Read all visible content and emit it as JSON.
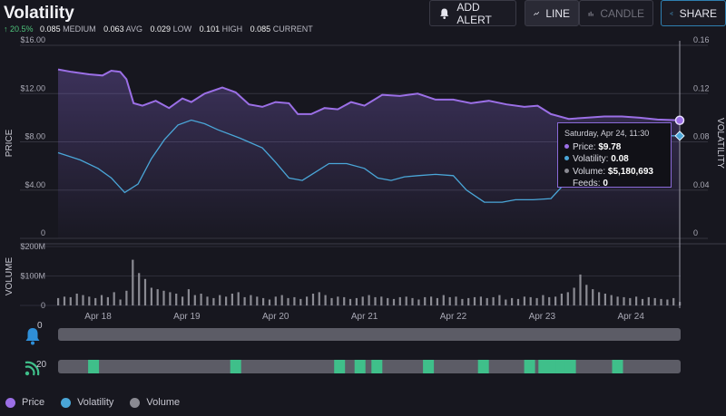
{
  "header": {
    "title": "Volatility",
    "change": "↑ 20.5%",
    "stats": [
      {
        "value": "0.085",
        "label": "MEDIUM"
      },
      {
        "value": "0.063",
        "label": "AVG"
      },
      {
        "value": "0.029",
        "label": "LOW"
      },
      {
        "value": "0.101",
        "label": "HIGH"
      },
      {
        "value": "0.085",
        "label": "CURRENT"
      }
    ]
  },
  "toolbar": {
    "add_alert": "ADD ALERT",
    "line": "LINE",
    "candle": "CANDLE",
    "share": "SHARE"
  },
  "tooltip": {
    "date": "Saturday, Apr 24, 11:30",
    "price_label": "Price:",
    "price": "$9.78",
    "vol_label": "Volatility:",
    "vol": "0.08",
    "volume_label": "Volume:",
    "volume": "$5,180,693",
    "feeds_label": "Feeds:",
    "feeds": "0"
  },
  "lanes": {
    "alerts_count": "0",
    "feeds_count": "20"
  },
  "colors": {
    "price": "#9b6fe6",
    "volatility": "#4aa6d8",
    "volume": "#8a8a92",
    "feed": "#3fbf8a"
  },
  "chart_data": {
    "type": "line",
    "xlabel": "",
    "ylabel": "PRICE",
    "y2label": "VOLATILITY",
    "ylim": [
      0,
      16
    ],
    "y2lim": [
      0,
      0.16
    ],
    "volume_label": "VOLUME",
    "volume_ylim": [
      0,
      200000000
    ],
    "x_ticks": [
      "Apr 18",
      "Apr 19",
      "Apr 20",
      "Apr 21",
      "Apr 22",
      "Apr 23",
      "Apr 24"
    ],
    "y_ticks": [
      "$16.00",
      "$12.00",
      "$8.00",
      "$4.00",
      "0"
    ],
    "y2_ticks": [
      "0.16",
      "0.12",
      "0.08",
      "0.04",
      "0"
    ],
    "volume_ticks": [
      "$200M",
      "$100M",
      "0"
    ],
    "legend": [
      "Price",
      "Volatility",
      "Volume"
    ],
    "x_range": [
      17.55,
      24.55
    ],
    "series": [
      {
        "name": "Price",
        "x": [
          17.55,
          17.7,
          17.9,
          18.05,
          18.15,
          18.25,
          18.32,
          18.4,
          18.5,
          18.65,
          18.8,
          18.95,
          19.05,
          19.2,
          19.4,
          19.55,
          19.7,
          19.85,
          20.0,
          20.15,
          20.25,
          20.4,
          20.55,
          20.7,
          20.85,
          21.0,
          21.2,
          21.4,
          21.6,
          21.8,
          22.0,
          22.2,
          22.4,
          22.6,
          22.8,
          22.95,
          23.1,
          23.3,
          23.5,
          23.7,
          23.9,
          24.1,
          24.3,
          24.55
        ],
        "values": [
          14.0,
          13.8,
          13.6,
          13.5,
          13.9,
          13.8,
          13.2,
          11.2,
          11.0,
          11.4,
          10.8,
          11.6,
          11.3,
          12.0,
          12.5,
          12.1,
          11.1,
          10.9,
          11.3,
          11.2,
          10.3,
          10.3,
          10.8,
          10.7,
          11.3,
          11.0,
          11.9,
          11.8,
          12.0,
          11.5,
          11.5,
          11.2,
          11.4,
          11.1,
          10.9,
          11.0,
          10.3,
          9.9,
          10.0,
          10.1,
          10.1,
          10.0,
          9.85,
          9.78
        ]
      },
      {
        "name": "Volatility",
        "x": [
          17.55,
          17.8,
          18.0,
          18.15,
          18.3,
          18.45,
          18.6,
          18.75,
          18.9,
          19.05,
          19.2,
          19.35,
          19.6,
          19.85,
          20.0,
          20.15,
          20.3,
          20.45,
          20.6,
          20.8,
          21.0,
          21.15,
          21.3,
          21.45,
          21.6,
          21.8,
          22.0,
          22.15,
          22.35,
          22.55,
          22.7,
          22.9,
          23.1,
          23.25,
          23.45,
          23.65,
          23.85,
          24.05,
          24.25,
          24.45,
          24.55
        ],
        "values": [
          0.071,
          0.065,
          0.058,
          0.05,
          0.038,
          0.045,
          0.066,
          0.082,
          0.094,
          0.098,
          0.095,
          0.09,
          0.083,
          0.075,
          0.063,
          0.05,
          0.048,
          0.055,
          0.062,
          0.062,
          0.058,
          0.05,
          0.048,
          0.051,
          0.052,
          0.053,
          0.052,
          0.04,
          0.03,
          0.03,
          0.032,
          0.032,
          0.033,
          0.045,
          0.06,
          0.075,
          0.08,
          0.082,
          0.082,
          0.085,
          0.085
        ]
      },
      {
        "name": "Volume",
        "x": [
          17.55,
          17.62,
          17.69,
          17.76,
          17.83,
          17.9,
          17.97,
          18.04,
          18.11,
          18.18,
          18.25,
          18.32,
          18.39,
          18.46,
          18.53,
          18.6,
          18.67,
          18.74,
          18.81,
          18.88,
          18.95,
          19.02,
          19.09,
          19.16,
          19.23,
          19.3,
          19.37,
          19.44,
          19.51,
          19.58,
          19.65,
          19.72,
          19.79,
          19.86,
          19.93,
          20.0,
          20.07,
          20.14,
          20.21,
          20.28,
          20.35,
          20.42,
          20.49,
          20.56,
          20.63,
          20.7,
          20.77,
          20.84,
          20.91,
          20.98,
          21.05,
          21.12,
          21.19,
          21.26,
          21.33,
          21.4,
          21.47,
          21.54,
          21.61,
          21.68,
          21.75,
          21.82,
          21.89,
          21.96,
          22.03,
          22.1,
          22.17,
          22.24,
          22.31,
          22.38,
          22.45,
          22.52,
          22.59,
          22.66,
          22.73,
          22.8,
          22.87,
          22.94,
          23.01,
          23.08,
          23.15,
          23.22,
          23.29,
          23.36,
          23.43,
          23.5,
          23.57,
          23.64,
          23.71,
          23.78,
          23.85,
          23.92,
          23.99,
          24.06,
          24.13,
          24.2,
          24.27,
          24.34,
          24.41,
          24.48,
          24.55
        ],
        "values": [
          25,
          30,
          28,
          40,
          35,
          30,
          25,
          35,
          28,
          45,
          20,
          50,
          155,
          110,
          90,
          60,
          55,
          50,
          45,
          40,
          30,
          55,
          35,
          40,
          30,
          25,
          35,
          30,
          40,
          45,
          28,
          35,
          30,
          25,
          20,
          30,
          35,
          25,
          28,
          22,
          30,
          40,
          45,
          35,
          25,
          30,
          28,
          22,
          25,
          30,
          35,
          28,
          30,
          25,
          22,
          28,
          30,
          25,
          20,
          28,
          30,
          25,
          35,
          28,
          30,
          22,
          25,
          28,
          30,
          25,
          28,
          35,
          20,
          25,
          22,
          30,
          28,
          25,
          35,
          28,
          30,
          40,
          45,
          60,
          105,
          70,
          55,
          45,
          40,
          35,
          30,
          28,
          25,
          30,
          22,
          28,
          25,
          22,
          20,
          25,
          12
        ]
      }
    ],
    "feed_marks": [
      17.95,
      19.55,
      20.72,
      20.95,
      21.14,
      21.72,
      22.34,
      22.86,
      23.02,
      23.14,
      23.22,
      23.32,
      23.85
    ]
  }
}
